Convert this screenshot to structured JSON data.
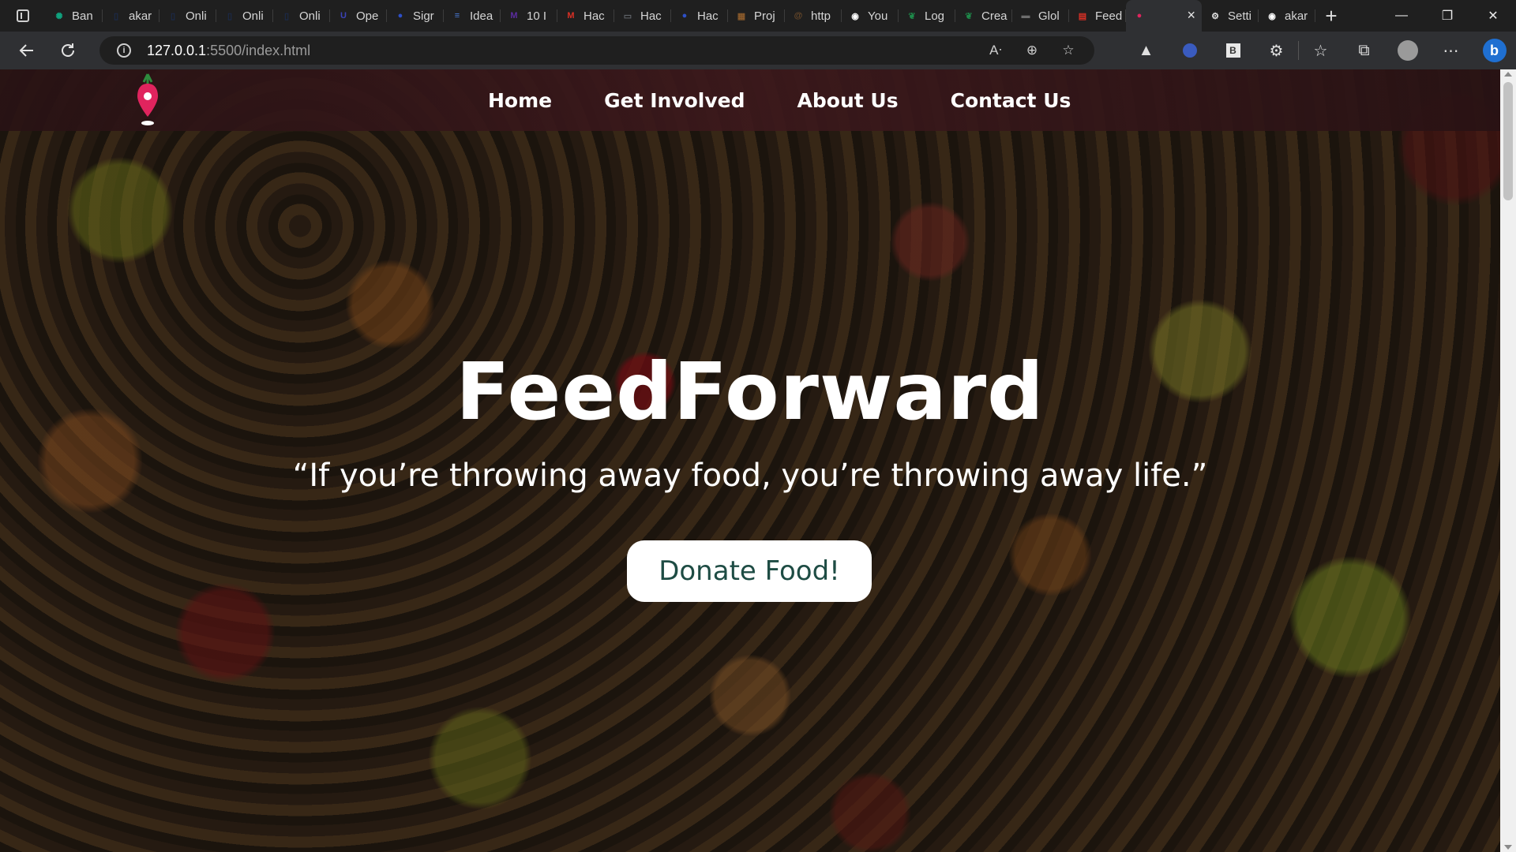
{
  "browser": {
    "tabs": [
      {
        "label": "Ban",
        "icon": "chatgpt-icon",
        "color": "#10a37f"
      },
      {
        "label": "akar",
        "icon": "page-icon",
        "color": "#1b2a4a"
      },
      {
        "label": "Onli",
        "icon": "page-icon",
        "color": "#1b2a4a"
      },
      {
        "label": "Onli",
        "icon": "page-icon",
        "color": "#1b2a4a"
      },
      {
        "label": "Onli",
        "icon": "page-icon",
        "color": "#1b2a4a"
      },
      {
        "label": "Ope",
        "icon": "ui-icon",
        "color": "#3b43b8"
      },
      {
        "label": "Sigr",
        "icon": "blue-blob-icon",
        "color": "#2d4fc7"
      },
      {
        "label": "Idea",
        "icon": "doc-icon",
        "color": "#4a7bd8"
      },
      {
        "label": "10 I",
        "icon": "m-icon",
        "color": "#5b2ca0"
      },
      {
        "label": "Hac",
        "icon": "gmail-icon",
        "color": "#d93025"
      },
      {
        "label": "Hac",
        "icon": "file-icon",
        "color": "#5f6368"
      },
      {
        "label": "Hac",
        "icon": "blue-blob-icon",
        "color": "#2d4fc7"
      },
      {
        "label": "Proj",
        "icon": "mosaic-icon",
        "color": "#8a5a2b"
      },
      {
        "label": "http",
        "icon": "swirl-icon",
        "color": "#6b4a2a"
      },
      {
        "label": "You",
        "icon": "github-icon",
        "color": "#ffffff"
      },
      {
        "label": "Log",
        "icon": "leaf-icon",
        "color": "#1e8a4a"
      },
      {
        "label": "Crea",
        "icon": "leaf-icon",
        "color": "#1e8a4a"
      },
      {
        "label": "Glol",
        "icon": "card-icon",
        "color": "#6d6d6d"
      },
      {
        "label": "Feed",
        "icon": "pdf-icon",
        "color": "#d93025"
      }
    ],
    "active_tab": {
      "icon": "map-pin-icon",
      "color": "#e0245e",
      "close": "×"
    },
    "trailing_tabs": [
      {
        "label": "Setti",
        "icon": "gear-icon",
        "color": "#e0e0e0"
      },
      {
        "label": "akar",
        "icon": "github-icon",
        "color": "#ffffff"
      }
    ],
    "new_tab": "+",
    "window": {
      "minimize": "—",
      "restore": "❐",
      "close": "✕"
    },
    "url_host": "127.0.0.1",
    "url_rest": ":5500/index.html"
  },
  "site": {
    "nav": [
      "Home",
      "Get Involved",
      "About Us",
      "Contact Us"
    ],
    "title": "FeedForward",
    "quote": "“If you’re throwing away food, you’re throwing away life.”",
    "cta": "Donate Food!",
    "accent": "#1e4c44",
    "logo_color": "#e0245e"
  }
}
